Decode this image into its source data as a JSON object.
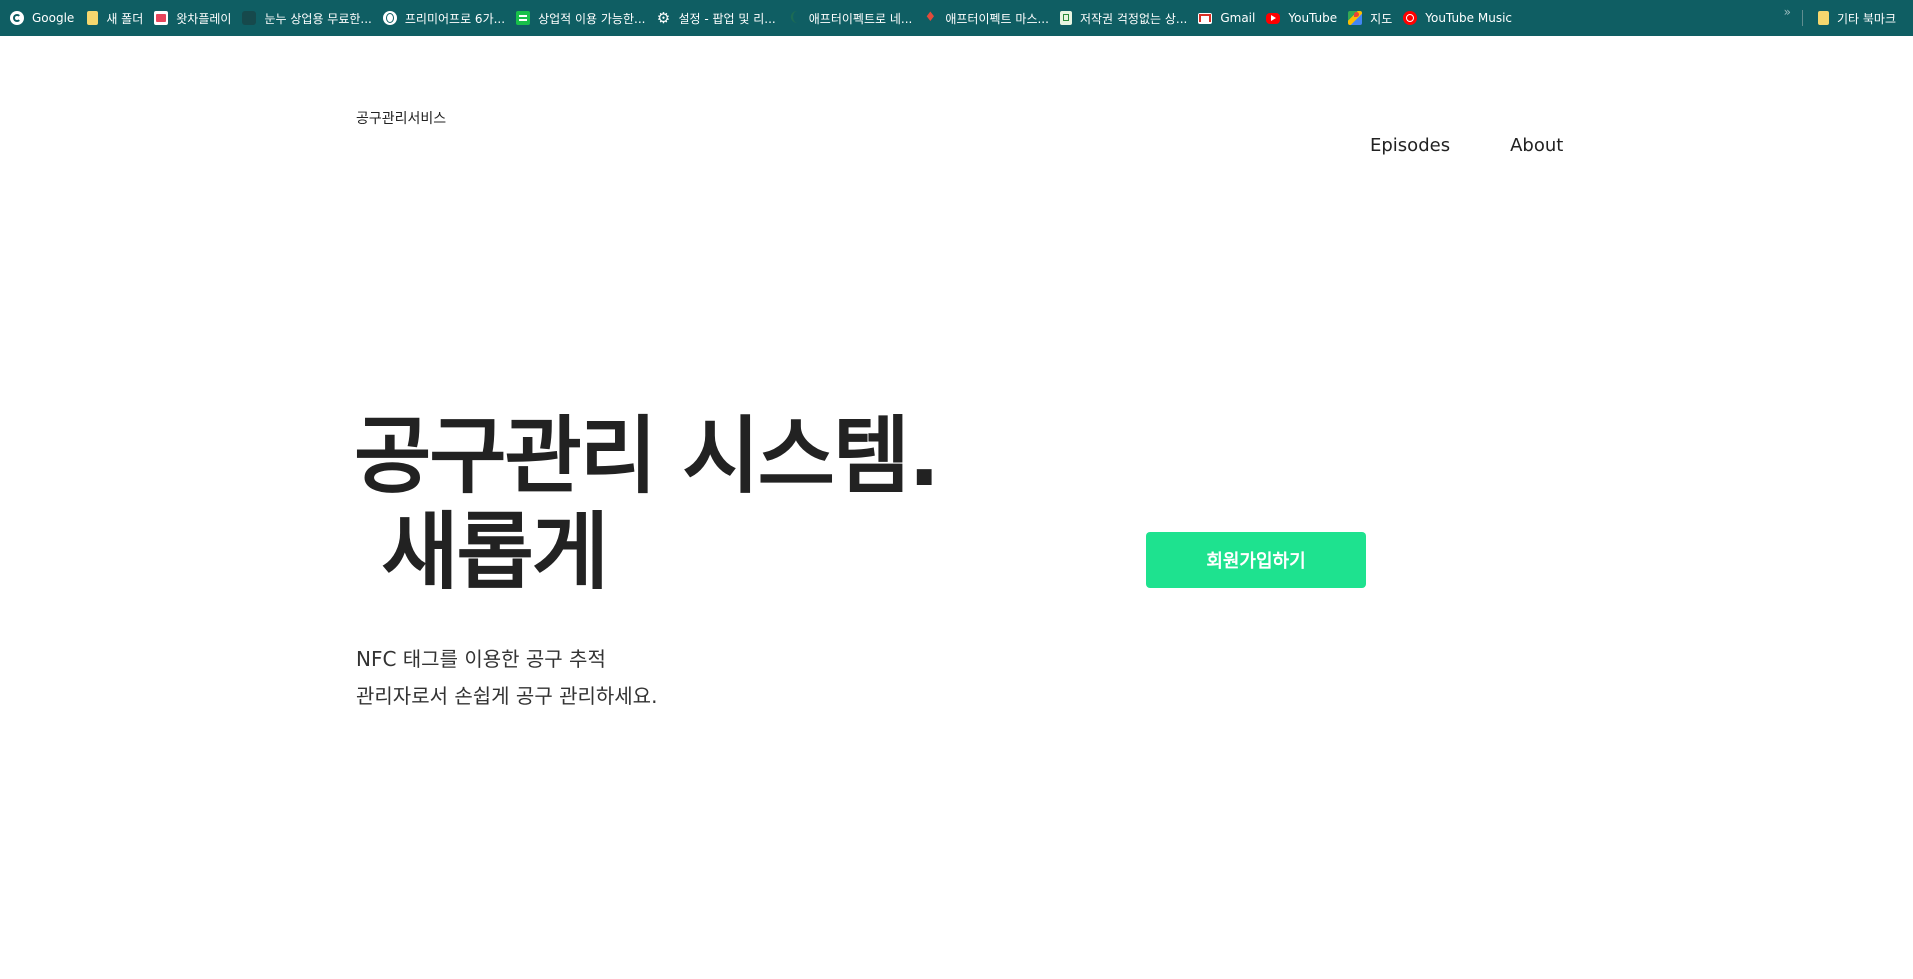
{
  "bookmarks": {
    "items": [
      {
        "label": "Google",
        "icon": "google-icon"
      },
      {
        "label": "새 폴더",
        "icon": "folder-icon"
      },
      {
        "label": "왓차플레이",
        "icon": "watcha-icon"
      },
      {
        "label": "눈누 상업용 무료한...",
        "icon": "nunu-icon"
      },
      {
        "label": "프리미어프로 6가...",
        "icon": "globe-icon"
      },
      {
        "label": "상업적 이용 가능한...",
        "icon": "green-square-icon"
      },
      {
        "label": "설정 - 팝업 및 리...",
        "icon": "gear-icon"
      },
      {
        "label": "애프터이펙트로 네...",
        "icon": "leaf-icon"
      },
      {
        "label": "애프터이펙트 마스...",
        "icon": "drop-icon"
      },
      {
        "label": "저작권 걱정없는 상...",
        "icon": "sheet-icon"
      },
      {
        "label": "Gmail",
        "icon": "gmail-icon"
      },
      {
        "label": "YouTube",
        "icon": "youtube-icon"
      },
      {
        "label": "지도",
        "icon": "maps-icon"
      },
      {
        "label": "YouTube Music",
        "icon": "youtube-music-icon"
      }
    ],
    "overflow": "»",
    "other": "기타 북마크"
  },
  "site": {
    "brand": "공구관리서비스",
    "nav": [
      "Episodes",
      "About"
    ]
  },
  "hero": {
    "title_line1": "공구관리 시스템.",
    "title_line2": " 새롭게",
    "sub_line1": "NFC 태그를 이용한 공구 추적",
    "sub_line2": "관리자로서 손쉽게 공구 관리하세요.",
    "cta": "회원가입하기"
  },
  "colors": {
    "bookmarks_bar": "#0f5e63",
    "cta": "#1ee28f",
    "text": "#222222"
  }
}
